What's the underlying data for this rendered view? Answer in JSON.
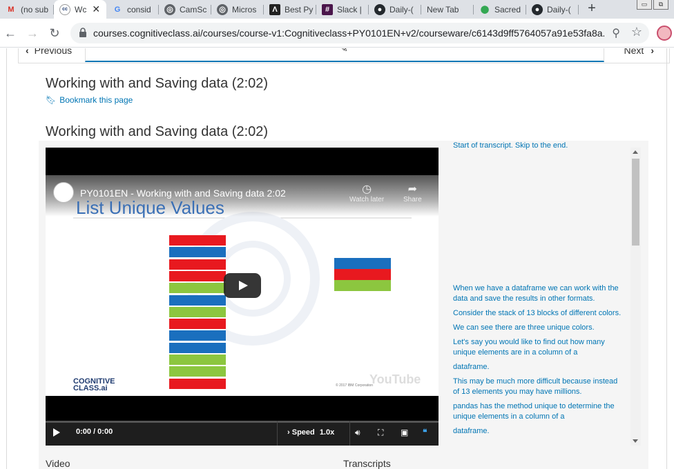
{
  "tabs": [
    {
      "label": "(no sub",
      "icon": "gmail-icon"
    },
    {
      "label": "Wc",
      "icon": "cognitiveclass-icon",
      "active": true
    },
    {
      "label": "consid",
      "icon": "google-icon"
    },
    {
      "label": "CamSc",
      "icon": "globe-icon"
    },
    {
      "label": "Micros",
      "icon": "globe-icon"
    },
    {
      "label": "Best Py",
      "icon": "app-icon"
    },
    {
      "label": "Slack |",
      "icon": "slack-icon"
    },
    {
      "label": "Daily-(",
      "icon": "github-icon"
    },
    {
      "label": "New Tab",
      "icon": ""
    },
    {
      "label": "Sacred",
      "icon": "maps-icon"
    },
    {
      "label": "Daily-(",
      "icon": "github-icon"
    }
  ],
  "toolbar": {
    "url": "courses.cognitiveclass.ai/courses/course-v1:Cognitiveclass+PY0101EN+v2/courseware/c6143d9ff5764057a91e53fa8a..."
  },
  "seqnav": {
    "previous": "Previous",
    "next": "Next"
  },
  "unit": {
    "title": "Working with and Saving data (2:02)",
    "bookmark": "Bookmark this page",
    "video_heading": "Working with and Saving data (2:02)"
  },
  "video": {
    "title": "PY0101EN - Working with and Saving data 2:02",
    "slide_title": "List Unique Values",
    "watch_later": "Watch later",
    "share": "Share",
    "brand_line1": "COGNITIVE",
    "brand_line2": "CLASS.ai",
    "copyright": "© 2017 IBM Corporation",
    "youtube": "YouTube",
    "time": "0:00 / 0:00",
    "speed_label": "Speed",
    "speed_value": "1.0x",
    "stack_colors": [
      "red",
      "blue",
      "red",
      "red",
      "green",
      "blue",
      "green",
      "red",
      "blue",
      "blue",
      "green",
      "green",
      "red"
    ],
    "unique_colors": [
      "blue",
      "red",
      "green"
    ],
    "colors": {
      "red": "#e8191f",
      "blue": "#1a6fbe",
      "green": "#8cc63f"
    }
  },
  "transcript": {
    "lines": [
      "Start of transcript. Skip to the end.",
      "When we have a dataframe we can work with the data and save the results in other formats.",
      "Consider the stack of 13 blocks of different colors.",
      "We can see there are three unique colors.",
      "Let's say you would like to find out how many unique elements are in a column of a",
      "dataframe.",
      "This may be much more difficult because instead of 13 elements you may have millions.",
      "pandas has the method unique to determine the unique elements in a column of a",
      "dataframe."
    ]
  },
  "footer_labels": {
    "video": "Video",
    "transcripts": "Transcripts"
  }
}
